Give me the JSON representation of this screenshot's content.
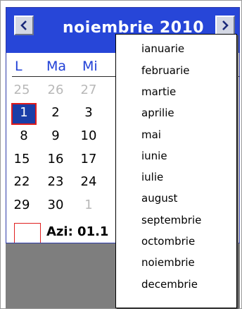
{
  "calendar": {
    "month_title": "noiembrie 2010",
    "weekdays": [
      "L",
      "Ma",
      "Mi"
    ],
    "weeks": [
      [
        "25",
        "26",
        "27"
      ],
      [
        "1",
        "2",
        "3"
      ],
      [
        "8",
        "9",
        "10"
      ],
      [
        "15",
        "16",
        "17"
      ],
      [
        "22",
        "23",
        "24"
      ],
      [
        "29",
        "30",
        "1"
      ]
    ],
    "today_label": "Azi: 01.1"
  },
  "month_menu": {
    "items": [
      "ianuarie",
      "februarie",
      "martie",
      "aprilie",
      "mai",
      "iunie",
      "iulie",
      "august",
      "septembrie",
      "octombrie",
      "noiembrie",
      "decembrie"
    ]
  },
  "icons": {
    "prev": "chevron-left-icon",
    "next": "chevron-right-icon"
  },
  "colors": {
    "header": "#2746d8",
    "selected_day": "#1a3ea8",
    "selection_border": "#e01b1b",
    "weekday_text": "#1f3fd6",
    "other_month_text": "#b8b8b8"
  }
}
